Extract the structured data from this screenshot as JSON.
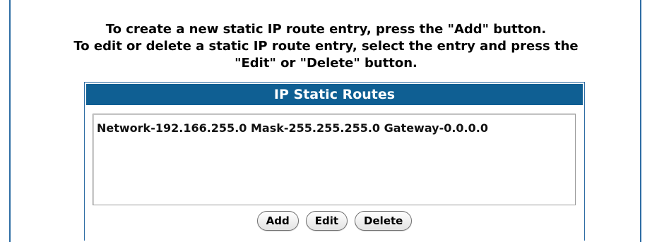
{
  "instructions": {
    "line1": "To create a new static IP route entry, press the \"Add\" button.",
    "line2": "To edit or delete a static IP route entry, select the entry and press the",
    "line3": "\"Edit\" or \"Delete\" button."
  },
  "panel": {
    "title": "IP Static Routes"
  },
  "routes": [
    "Network-192.166.255.0 Mask-255.255.255.0 Gateway-0.0.0.0"
  ],
  "buttons": {
    "add": "Add",
    "edit": "Edit",
    "delete": "Delete"
  },
  "colors": {
    "header_bg": "#0f5f93",
    "frame": "#2e6da4"
  }
}
